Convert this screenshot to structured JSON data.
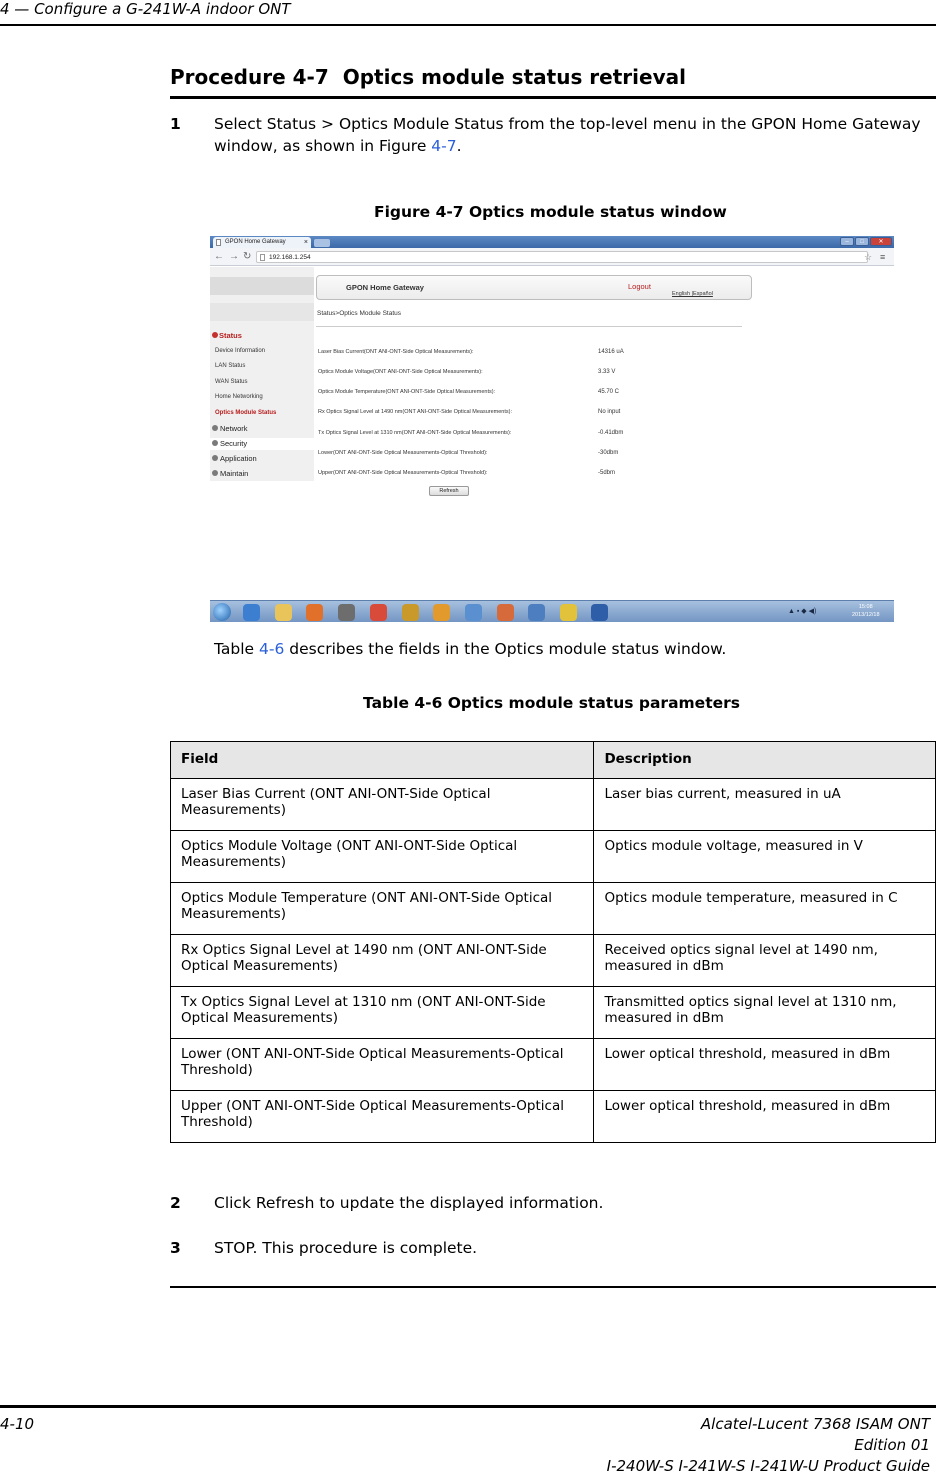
{
  "running_header": "4 — Configure a G-241W-A indoor ONT",
  "procedure": {
    "label": "Procedure 4-7",
    "title": "Optics module status retrieval"
  },
  "steps": [
    {
      "num": "1",
      "text_before": "Select Status > Optics Module Status from the top-level menu in the GPON Home Gateway window, as shown in Figure ",
      "xref": "4-7",
      "text_after": "."
    },
    {
      "num": "2",
      "text": "Click Refresh to update the displayed information."
    },
    {
      "num": "3",
      "text": "STOP. This procedure is complete."
    }
  ],
  "figure": {
    "title": "Figure 4-7  Optics module status window",
    "screenshot": {
      "tab_title": "GPON Home Gateway",
      "tab_close": "×",
      "url": "192.168.1.254",
      "header_title": "GPON Home Gateway",
      "logout": "Logout",
      "lang": "English |Español",
      "breadcrumb": "Status>Optics Module Status",
      "sidebar": {
        "status": "Status",
        "sub_items": [
          "Device Information",
          "LAN Status",
          "WAN Status",
          "Home Networking",
          "Optics Module Status"
        ],
        "groups": [
          "Network",
          "Security",
          "Application",
          "Maintain"
        ]
      },
      "rows": [
        {
          "label": "Laser Bias Current(ONT ANI-ONT-Side Optical Measurements):",
          "value": "14316 uA"
        },
        {
          "label": "Optics Module Voltage(ONT ANI-ONT-Side Optical Measurements):",
          "value": "3.33 V"
        },
        {
          "label": "Optics Module Temperature(ONT ANI-ONT-Side Optical Measurements):",
          "value": "45.70 C"
        },
        {
          "label": "Rx Optics Signal Level at 1490 nm(ONT ANI-ONT-Side Optical Measurements):",
          "value": "No input"
        },
        {
          "label": "Tx Optics Signal Level at 1310 nm(ONT ANI-ONT-Side Optical Measurements):",
          "value": "-0.41dbm"
        },
        {
          "label": "Lower(ONT ANI-ONT-Side Optical Measurements-Optical Threshold):",
          "value": "-30dbm"
        },
        {
          "label": "Upper(ONT ANI-ONT-Side Optical Measurements-Optical Threshold):",
          "value": "-5dbm"
        }
      ],
      "refresh_button": "Refresh",
      "clock_time": "15:08",
      "clock_date": "2013/12/18"
    }
  },
  "paragraph": {
    "before": "Table ",
    "xref": "4-6",
    "after": " describes the fields in the Optics module status window."
  },
  "table": {
    "title": "Table 4-6 Optics module status parameters",
    "headers": [
      "Field",
      "Description"
    ],
    "rows": [
      [
        "Laser Bias Current (ONT ANI-ONT-Side Optical Measurements)",
        "Laser bias current, measured in uA"
      ],
      [
        "Optics Module Voltage (ONT ANI-ONT-Side Optical Measurements)",
        "Optics module voltage, measured in V"
      ],
      [
        "Optics Module Temperature (ONT ANI-ONT-Side Optical Measurements)",
        "Optics module temperature, measured in C"
      ],
      [
        "Rx Optics Signal Level at 1490 nm (ONT ANI-ONT-Side Optical Measurements)",
        "Received optics signal level at 1490 nm, measured in dBm"
      ],
      [
        "Tx Optics Signal Level at 1310 nm (ONT ANI-ONT-Side Optical Measurements)",
        "Transmitted optics signal level at 1310 nm, measured in dBm"
      ],
      [
        "Lower (ONT ANI-ONT-Side Optical Measurements-Optical Threshold)",
        "Lower optical threshold, measured in dBm"
      ],
      [
        "Upper (ONT ANI-ONT-Side Optical Measurements-Optical Threshold)",
        "Lower optical threshold, measured in dBm"
      ]
    ]
  },
  "footer": {
    "page": "4-10",
    "product": "Alcatel-Lucent 7368 ISAM ONT",
    "edition": "Edition 01",
    "guide": "I-240W-S I-241W-S I-241W-U Product Guide"
  }
}
